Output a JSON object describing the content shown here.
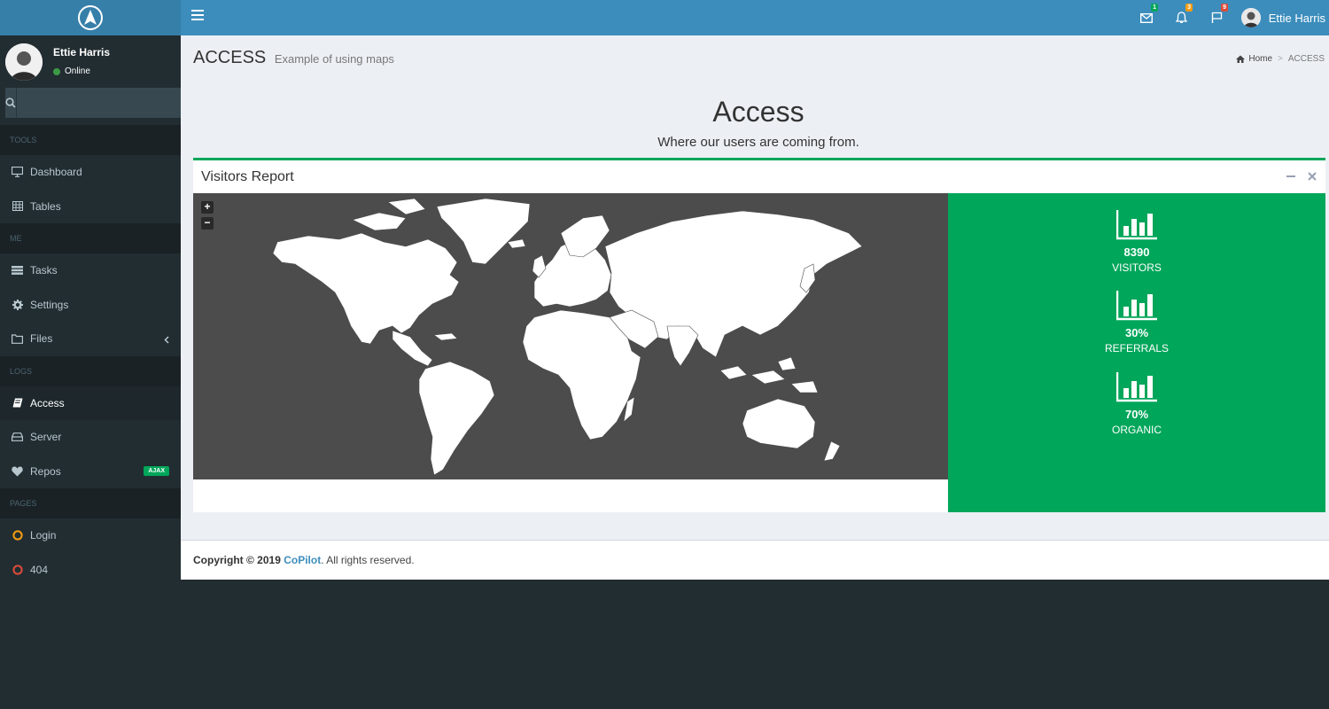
{
  "topbar": {
    "user_name": "Ettie Harris",
    "messages_count": "1",
    "notifications_count": "3",
    "tasks_count": "9"
  },
  "sidebar": {
    "user_name": "Ettie Harris",
    "status": "Online",
    "search_placeholder": "",
    "sections": {
      "tools": "TOOLS",
      "me": "ME",
      "logs": "LOGS",
      "pages": "PAGES"
    },
    "items": {
      "dashboard": "Dashboard",
      "tables": "Tables",
      "tasks": "Tasks",
      "settings": "Settings",
      "files": "Files",
      "access": "Access",
      "server": "Server",
      "repos": "Repos",
      "repos_badge": "AJAX",
      "login": "Login",
      "notfound": "404"
    }
  },
  "header": {
    "title": "ACCESS",
    "subtitle": "Example of using maps",
    "breadcrumb_home": "Home",
    "breadcrumb_current": "ACCESS"
  },
  "main": {
    "heading": "Access",
    "subheading": "Where our users are coming from."
  },
  "box": {
    "title": "Visitors Report",
    "zoom_in": "+",
    "zoom_out": "−"
  },
  "stats": [
    {
      "value": "8390",
      "label": "VISITORS"
    },
    {
      "value": "30%",
      "label": "REFERRALS"
    },
    {
      "value": "70%",
      "label": "ORGANIC"
    }
  ],
  "footer": {
    "prefix": "Copyright © 2019 ",
    "brand": "CoPilot",
    "suffix": ". All rights reserved."
  },
  "colors": {
    "header": "#3c8dbc",
    "sidebar": "#222d32",
    "accent": "#00a65a",
    "map_background": "#4c4c4c"
  }
}
